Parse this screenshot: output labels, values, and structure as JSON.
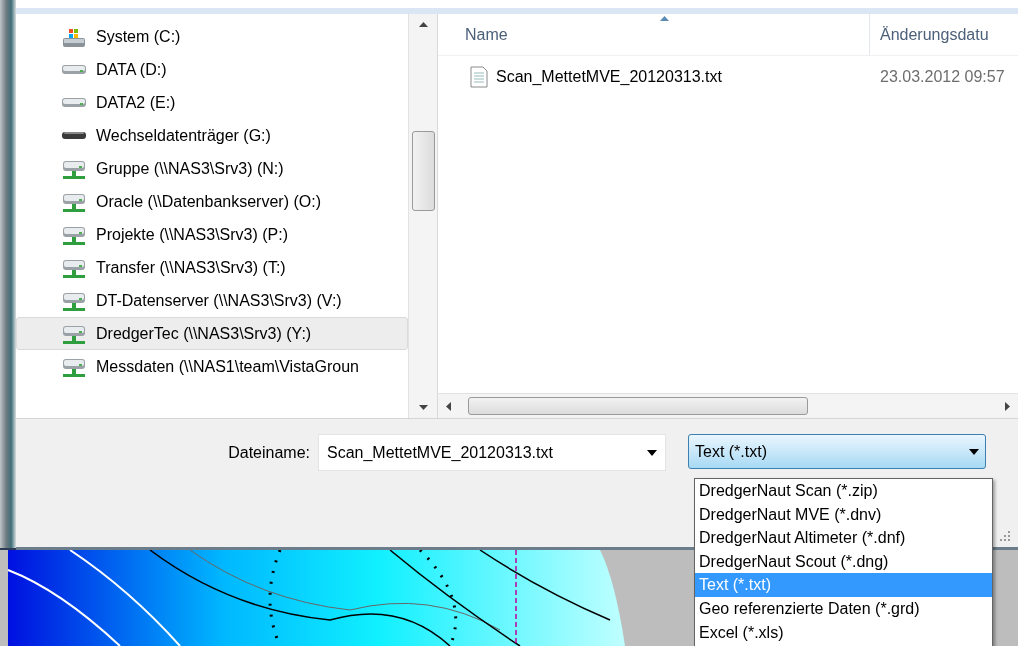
{
  "navigation": {
    "items": [
      {
        "label": "System (C:)",
        "kind": "system",
        "selected": false
      },
      {
        "label": "DATA (D:)",
        "kind": "drive",
        "selected": false
      },
      {
        "label": "DATA2 (E:)",
        "kind": "drive",
        "selected": false
      },
      {
        "label": "Wechseldatenträger (G:)",
        "kind": "removable",
        "selected": false
      },
      {
        "label": "Gruppe (\\\\NAS3\\Srv3) (N:)",
        "kind": "network",
        "selected": false
      },
      {
        "label": "Oracle (\\\\Datenbankserver) (O:)",
        "kind": "network",
        "selected": false
      },
      {
        "label": "Projekte (\\\\NAS3\\Srv3) (P:)",
        "kind": "network",
        "selected": false
      },
      {
        "label": "Transfer (\\\\NAS3\\Srv3) (T:)",
        "kind": "network",
        "selected": false
      },
      {
        "label": "DT-Datenserver (\\\\NAS3\\Srv3) (V:)",
        "kind": "network",
        "selected": false
      },
      {
        "label": "DredgerTec (\\\\NAS3\\Srv3) (Y:)",
        "kind": "network",
        "selected": true
      },
      {
        "label": "Messdaten (\\\\NAS1\\team\\VistaGroun",
        "kind": "network",
        "selected": false
      }
    ]
  },
  "file_list": {
    "columns": [
      {
        "label": "Name",
        "sorted": true
      },
      {
        "label": "Änderungsdatu",
        "sorted": false
      }
    ],
    "rows": [
      {
        "name": "Scan_MettetMVE_20120313.txt",
        "modified": "23.03.2012 09:57"
      }
    ]
  },
  "file_name": {
    "label": "Dateiname:",
    "value": "Scan_MettetMVE_20120313.txt"
  },
  "file_type": {
    "value": "Text (*.txt)",
    "expanded": true,
    "options": [
      {
        "label": "DredgerNaut Scan (*.zip)",
        "selected": false
      },
      {
        "label": "DredgerNaut MVE (*.dnv)",
        "selected": false
      },
      {
        "label": "DredgerNaut Altimeter (*.dnf)",
        "selected": false
      },
      {
        "label": "DredgerNaut Scout (*.dng)",
        "selected": false
      },
      {
        "label": "Text (*.txt)",
        "selected": true
      },
      {
        "label": "Geo referenzierte Daten (*.grd)",
        "selected": false
      },
      {
        "label": "Excel (*.xls)",
        "selected": false
      }
    ]
  }
}
